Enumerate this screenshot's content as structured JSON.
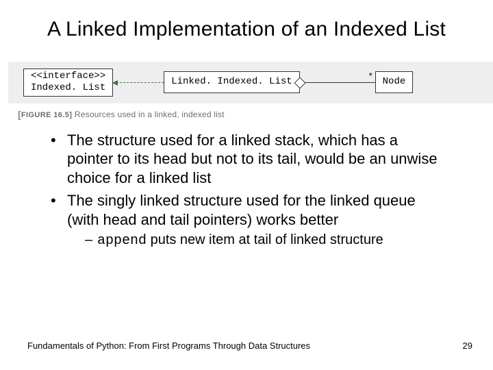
{
  "title": "A Linked Implementation of an Indexed List",
  "figure": {
    "interface_stereotype": "<<interface>>",
    "interface_name": "Indexed. List",
    "class_name": "Linked. Indexed. List",
    "assoc_multiplicity": "*",
    "assoc_target": "Node",
    "caption_bracket": "[",
    "caption_label": "FIGURE 16.5]",
    "caption_text": " Resources used in a linked, indexed list"
  },
  "bullets": [
    "The structure used for a linked stack, which has a pointer to its head but not to its tail, would be an unwise choice for a linked list",
    "The singly linked structure used for the linked queue (with head and tail pointers) works better"
  ],
  "sub_bullet_prefix": "append",
  "sub_bullet_rest": " puts new item at tail of linked structure",
  "footer_left": "Fundamentals of Python: From First Programs Through Data Structures",
  "footer_right": "29"
}
